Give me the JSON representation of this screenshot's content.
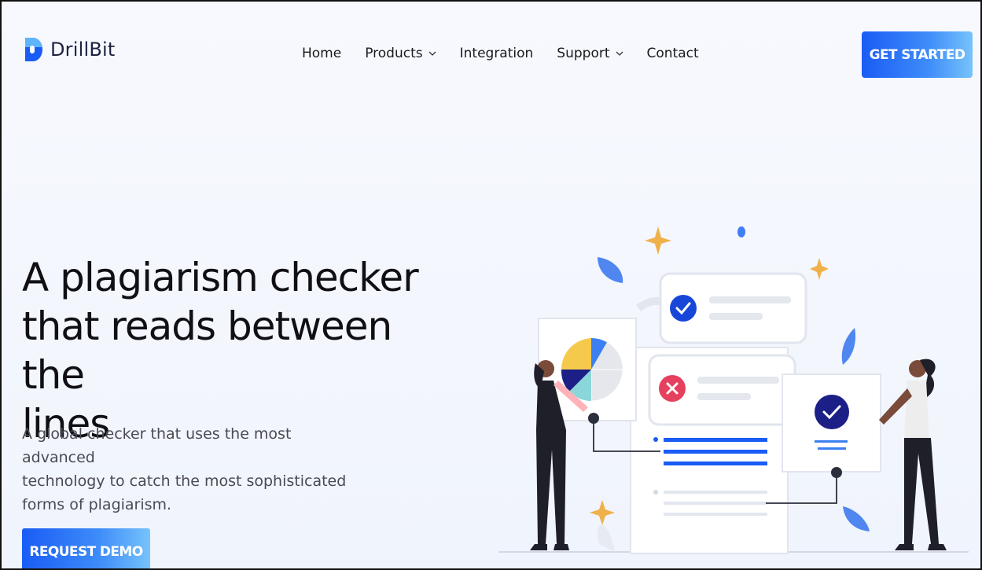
{
  "brand": {
    "name": "DrillBit",
    "primary_color": "#1a5cf5",
    "accent_color": "#76c3fb"
  },
  "nav": {
    "items": [
      {
        "label": "Home",
        "has_dropdown": false
      },
      {
        "label": "Products",
        "has_dropdown": true
      },
      {
        "label": "Integration",
        "has_dropdown": false
      },
      {
        "label": "Support",
        "has_dropdown": true
      },
      {
        "label": "Contact",
        "has_dropdown": false
      }
    ],
    "cta_label": "GET STARTED"
  },
  "hero": {
    "title_lines": [
      "A plagiarism checker",
      "that reads between the",
      "lines"
    ],
    "subtitle_lines": [
      "A global checker that uses the most advanced",
      "technology to catch the most sophisticated",
      "forms of plagiarism."
    ],
    "cta_label": "REQUEST DEMO"
  },
  "illustration": {
    "icons": [
      "pie-chart-icon",
      "check-icon",
      "cross-icon",
      "sparkle-icon",
      "leaf-icon"
    ],
    "colors": {
      "blue": "#1846d9",
      "red": "#e5405e",
      "gold": "#f0b04a",
      "yellow": "#f5c94c",
      "teal": "#8ad6d9"
    }
  }
}
